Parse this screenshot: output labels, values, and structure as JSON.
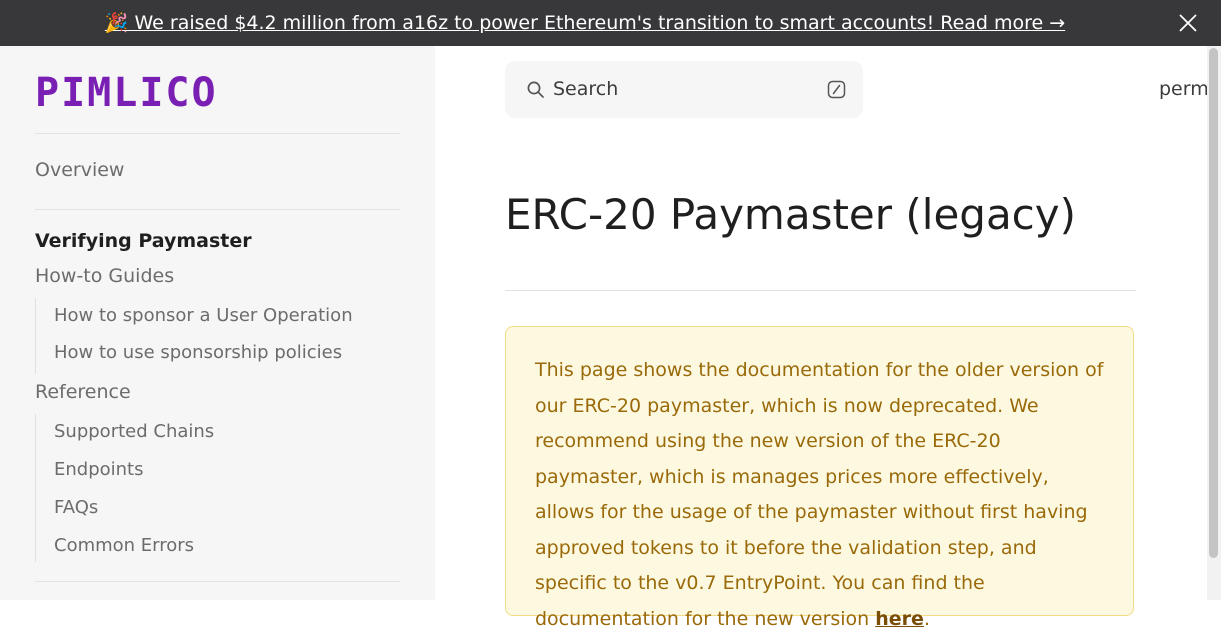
{
  "banner": {
    "text": "🎉 We raised $4.2 million from a16z to power Ethereum's transition to smart accounts! Read more →",
    "close_icon": "close-icon"
  },
  "sidebar": {
    "logo_text": "PIMLICO",
    "items": [
      {
        "label": "Overview"
      },
      {
        "label": "Verifying Paymaster"
      },
      {
        "label": "How-to Guides"
      },
      {
        "label": "How to sponsor a User Operation"
      },
      {
        "label": "How to use sponsorship policies"
      },
      {
        "label": "Reference"
      },
      {
        "label": "Supported Chains"
      },
      {
        "label": "Endpoints"
      },
      {
        "label": "FAQs"
      },
      {
        "label": "Common Errors"
      }
    ]
  },
  "search": {
    "label": "Search",
    "icon": "search-icon",
    "shortcut_icon": "slash-key-icon"
  },
  "topnav": {
    "link": "perm"
  },
  "main": {
    "title": "ERC-20 Paymaster (legacy)",
    "warning": {
      "text": "This page shows the documentation for the older version of our ERC-20 paymaster, which is now deprecated. We recommend using the new version of the ERC-20 paymaster, which is manages prices more effectively, allows for the usage of the paymaster without first having approved tokens to it before the validation step, and specific to the v0.7 EntryPoint. You can find the documentation for the new version ",
      "link": "here",
      "suffix": "."
    }
  },
  "colors": {
    "brand": "#7a1fb3",
    "banner_bg": "#38383a",
    "warning_bg": "#fdf9e1",
    "warning_border": "#f2dd86",
    "warning_text": "#9a6a0a"
  }
}
